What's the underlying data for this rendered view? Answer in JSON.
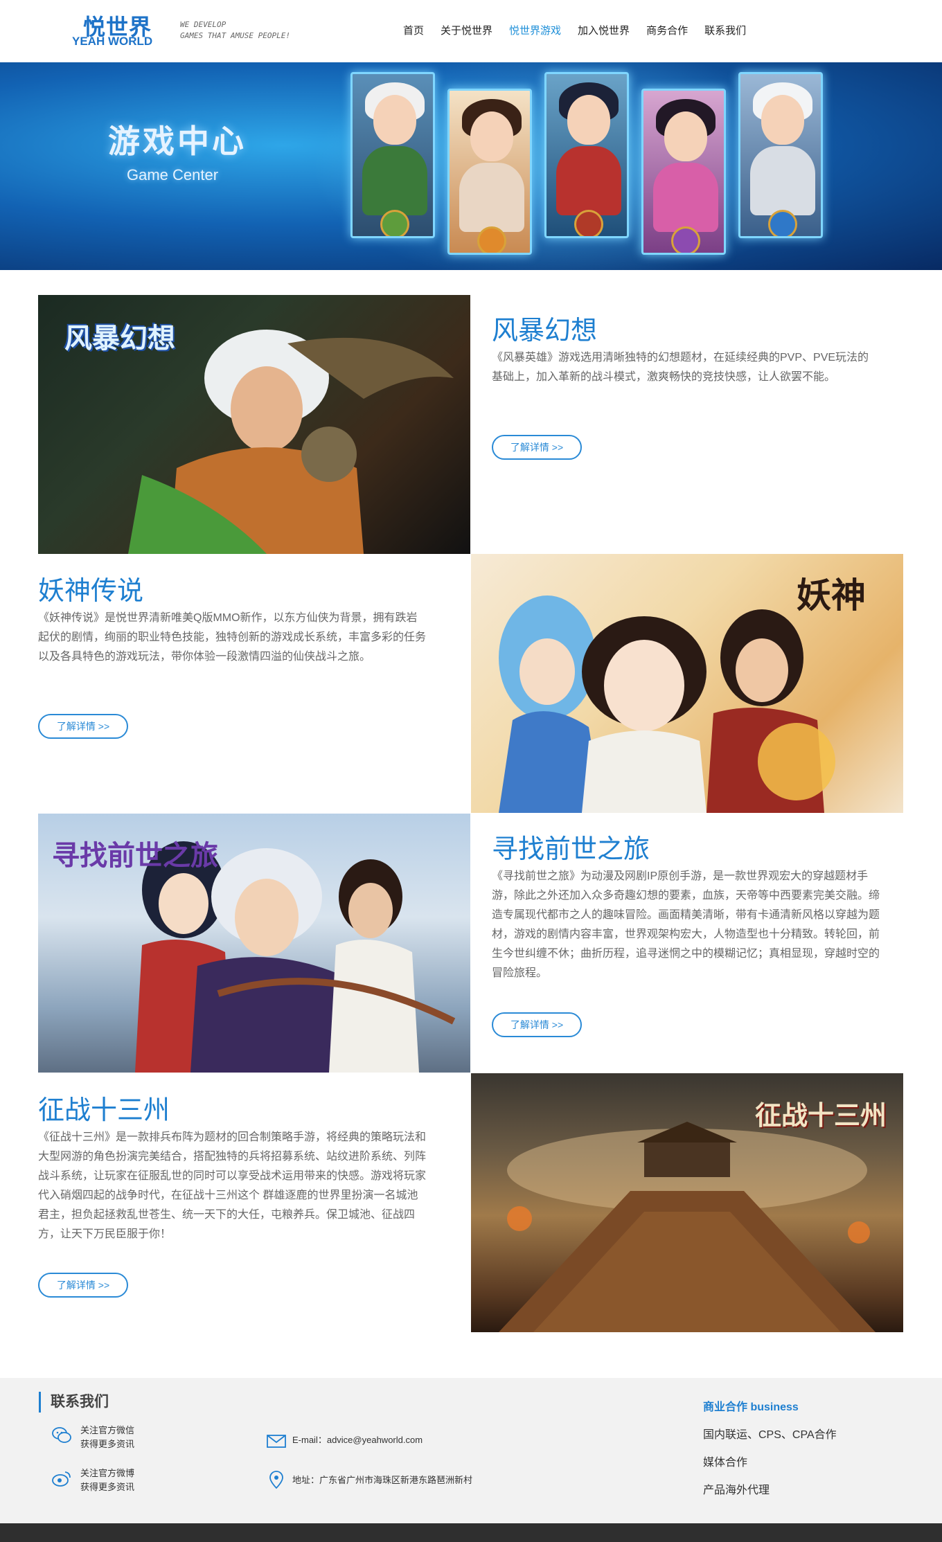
{
  "header": {
    "logo_cn": "悦世界",
    "logo_en": "YEAH WORLD",
    "slogan_line1": "WE DEVELOP",
    "slogan_line2": "GAMES THAT AMUSE PEOPLE!",
    "nav": [
      {
        "label": "首页",
        "active": false
      },
      {
        "label": "关于悦世界",
        "active": false
      },
      {
        "label": "悦世界游戏",
        "active": true
      },
      {
        "label": "加入悦世界",
        "active": false
      },
      {
        "label": "商务合作",
        "active": false
      },
      {
        "label": "联系我们",
        "active": false
      }
    ]
  },
  "banner": {
    "title": "游戏中心",
    "subtitle": "Game Center"
  },
  "games": [
    {
      "title": "风暴幻想",
      "image_logo": "风暴幻想",
      "description": "《风暴英雄》游戏选用清晰独特的幻想题材，在延续经典的PVP、PVE玩法的基础上，加入革新的战斗模式，激爽畅快的竞技快感，让人欲罢不能。",
      "button": "了解详情 >>"
    },
    {
      "title": "妖神传说",
      "image_logo": "妖神",
      "description": "《妖神传说》是悦世界清新唯美Q版MMO新作，以东方仙侠为背景，拥有跌岩起伏的剧情，绚丽的职业特色技能，独特创新的游戏成长系统，丰富多彩的任务以及各具特色的游戏玩法，带你体验一段激情四溢的仙侠战斗之旅。",
      "button": "了解详情 >>"
    },
    {
      "title": "寻找前世之旅",
      "image_logo": "寻找前世之旅",
      "description": "《寻找前世之旅》为动漫及网剧IP原创手游，是一款世界观宏大的穿越题材手游，除此之外还加入众多奇趣幻想的要素，血族，天帝等中西要素完美交融。缔造专属现代都市之人的趣味冒险。画面精美清晰，带有卡通清新风格以穿越为题材，游戏的剧情内容丰富，世界观架构宏大，人物造型也十分精致。转轮回，前生今世纠缠不休；曲折历程，追寻迷惘之中的模糊记忆；真相显现，穿越时空的冒险旅程。",
      "button": "了解详情 >>"
    },
    {
      "title": "征战十三州",
      "image_logo": "征战十三州",
      "description": "《征战十三州》是一款排兵布阵为题材的回合制策略手游，将经典的策略玩法和大型网游的角色扮演完美结合，搭配独特的兵将招募系统、站纹进阶系统、列阵战斗系统，让玩家在征服乱世的同时可以享受战术运用带来的快感。游戏将玩家代入硝烟四起的战争时代，在征战十三州这个 群雄逐鹿的世界里扮演一名城池君主，担负起拯救乱世苍生、统一天下的大任，屯粮养兵。保卫城池、征战四方，让天下万民臣服于你！",
      "button": "了解详情 >>"
    }
  ],
  "footer": {
    "contact_title": "联系我们",
    "wechat_line1": "关注官方微信",
    "wechat_line2": "获得更多资讯",
    "weibo_line1": "关注官方微博",
    "weibo_line2": "获得更多资讯",
    "email": "E-mail：advice@yeahworld.com",
    "address": "地址：广东省广州市海珠区新港东路琶洲新村",
    "business_title": "商业合作 business",
    "business_items": [
      "国内联运、CPS、CPA合作",
      "媒体合作",
      "产品海外代理"
    ]
  },
  "colors": {
    "brand_blue": "#1e7fd0",
    "nav_active": "#1e8fd8",
    "footer_bg": "#f2f2f2",
    "footer_bottom": "#2f2f2f"
  }
}
